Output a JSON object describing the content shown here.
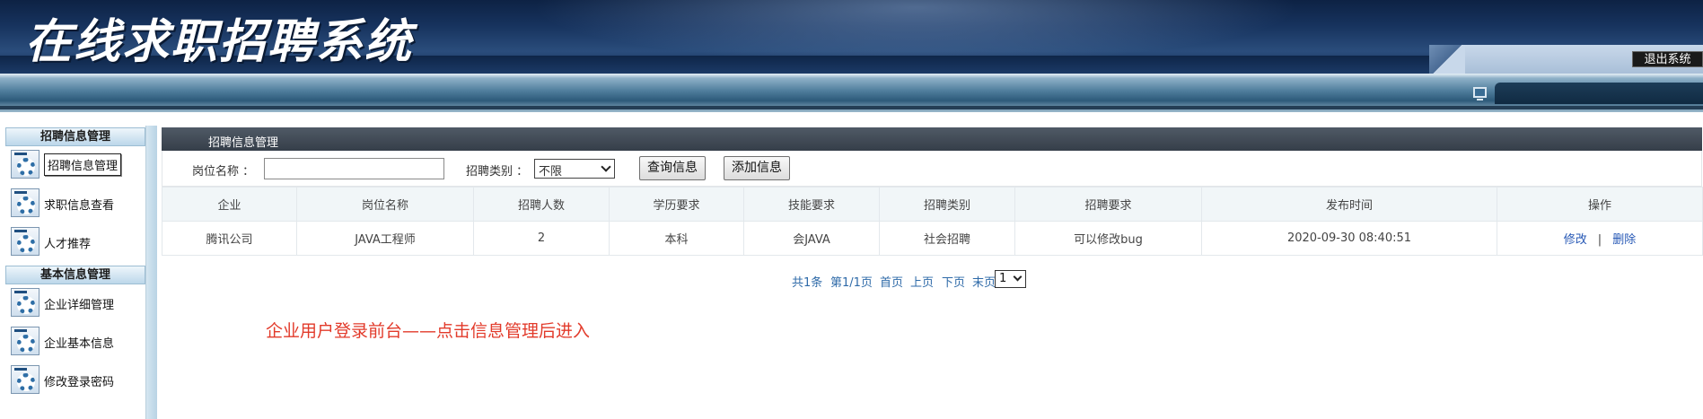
{
  "header": {
    "title": "在线求职招聘系统",
    "logout_label": "退出系统"
  },
  "sidebar": {
    "sections": [
      {
        "title": "招聘信息管理",
        "items": [
          {
            "label": "招聘信息管理",
            "icon": "gear-icon",
            "active": true
          },
          {
            "label": "求职信息查看",
            "icon": "gear-icon"
          },
          {
            "label": "人才推荐",
            "icon": "gear-icon"
          }
        ]
      },
      {
        "title": "基本信息管理",
        "items": [
          {
            "label": "企业详细管理",
            "icon": "gear-icon"
          },
          {
            "label": "企业基本信息",
            "icon": "gear-icon"
          },
          {
            "label": "修改登录密码",
            "icon": "gear-icon"
          }
        ]
      }
    ]
  },
  "main": {
    "page_title": "招聘信息管理",
    "search": {
      "position_label": "岗位名称 ：",
      "position_value": "",
      "category_label": "招聘类别 ：",
      "category_value": "不限",
      "query_button": "查询信息",
      "add_button": "添加信息"
    },
    "table": {
      "columns": [
        "企业",
        "岗位名称",
        "招聘人数",
        "学历要求",
        "技能要求",
        "招聘类别",
        "招聘要求",
        "发布时间",
        "操作"
      ],
      "rows": [
        {
          "company": "腾讯公司",
          "position": "JAVA工程师",
          "count": "2",
          "education": "本科",
          "skills": "会JAVA",
          "category": "社会招聘",
          "requirements": "可以修改bug",
          "publish_time": "2020-09-30 08:40:51",
          "edit_label": "修改",
          "delete_label": "删除"
        }
      ]
    },
    "pager": {
      "total": "共1条",
      "page_info": "第1/1页",
      "first": "首页",
      "prev": "上页",
      "next": "下页",
      "last": "末页",
      "page_select_value": "1"
    },
    "note": "企业用户登录前台——点击信息管理后进入"
  },
  "colors": {
    "header_bg": "#17335e",
    "page_head_bg": "#353e49",
    "link": "#2557b5",
    "note": "#e23a2a"
  }
}
